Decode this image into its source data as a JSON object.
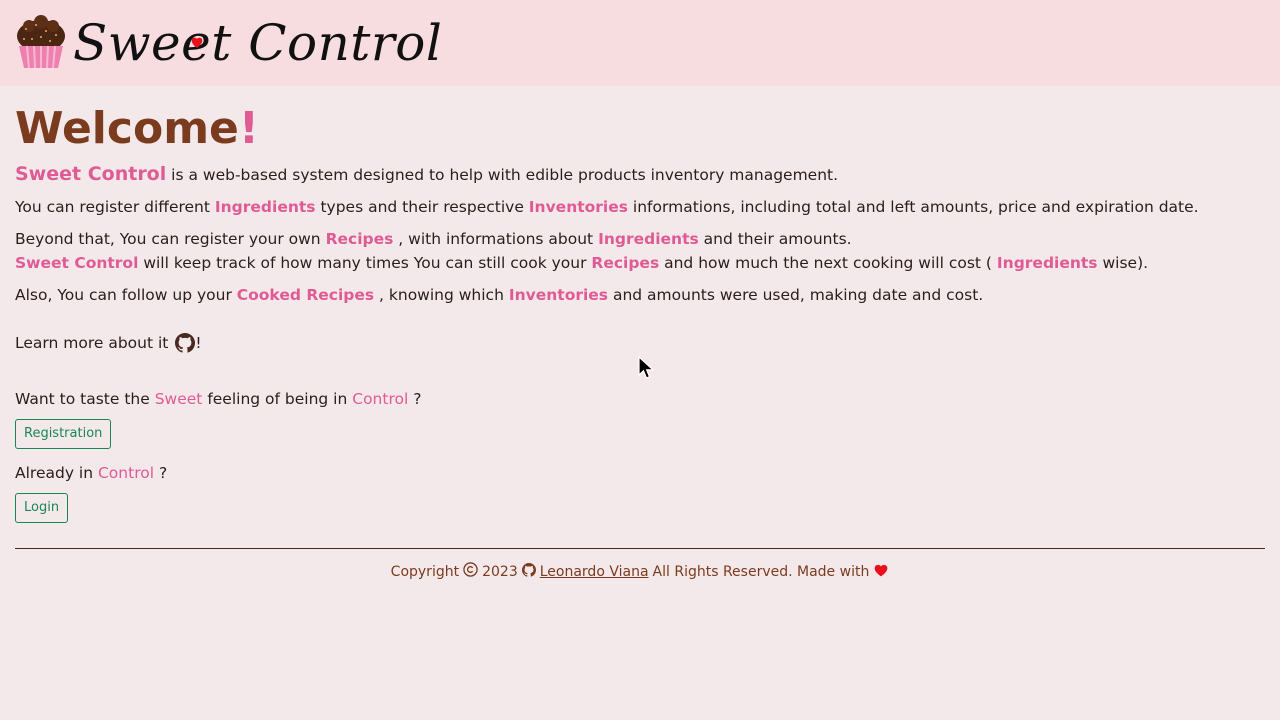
{
  "brand": {
    "title": "Sweet Control",
    "logo_icon": "cupcake-icon",
    "heart_icon": "heart-icon"
  },
  "welcome": {
    "title": "Welcome",
    "exclaim": "!"
  },
  "intro": {
    "brand": "Sweet Control",
    "text": " is a web-based system designed to help with edible products inventory management."
  },
  "p2": {
    "t1": "You can register different ",
    "ingredients": "Ingredients",
    "t2": " types and their respective ",
    "inventories": "Inventories",
    "t3": " informations, including total and left amounts, price and expiration date."
  },
  "p3": {
    "t1": "Beyond that, You can register your own ",
    "recipes": "Recipes",
    "t2": " , with informations about ",
    "ingredients": "Ingredients",
    "t3": " and their amounts."
  },
  "p4": {
    "brand": "Sweet Control",
    "t1": " will keep track of how many times You can still cook your ",
    "recipes": "Recipes",
    "t2": " and how much the next cooking will cost ( ",
    "ingredients": "Ingredients",
    "t3": " wise)."
  },
  "p5": {
    "t1": "Also, You can follow up your ",
    "cooked": "Cooked Recipes",
    "t2": " , knowing which ",
    "inventories": "Inventories",
    "t3": " and amounts were used, making date and cost."
  },
  "learn": {
    "text": "Learn more about it ",
    "icon": "github-icon",
    "after": "!"
  },
  "taste": {
    "t1": "Want to taste the ",
    "sweet": "Sweet",
    "t2": " feeling of being in ",
    "control": "Control",
    "t3": " ?"
  },
  "registration_button": "Registration",
  "already": {
    "t1": "Already in ",
    "control": "Control",
    "t2": " ?"
  },
  "login_button": "Login",
  "footer": {
    "copyright": "Copyright",
    "copyright_icon": "copyright-icon",
    "year": "2023",
    "author": "Leonardo Viana",
    "rights": "All Rights Reserved. Made with",
    "heart_icon": "heart-icon"
  },
  "colors": {
    "accent": "#e05a94",
    "heading": "#7a3b1e",
    "navbar": "#f8dde0",
    "background": "#f4e9ea",
    "button": "#198754",
    "heart": "#e8101c"
  }
}
